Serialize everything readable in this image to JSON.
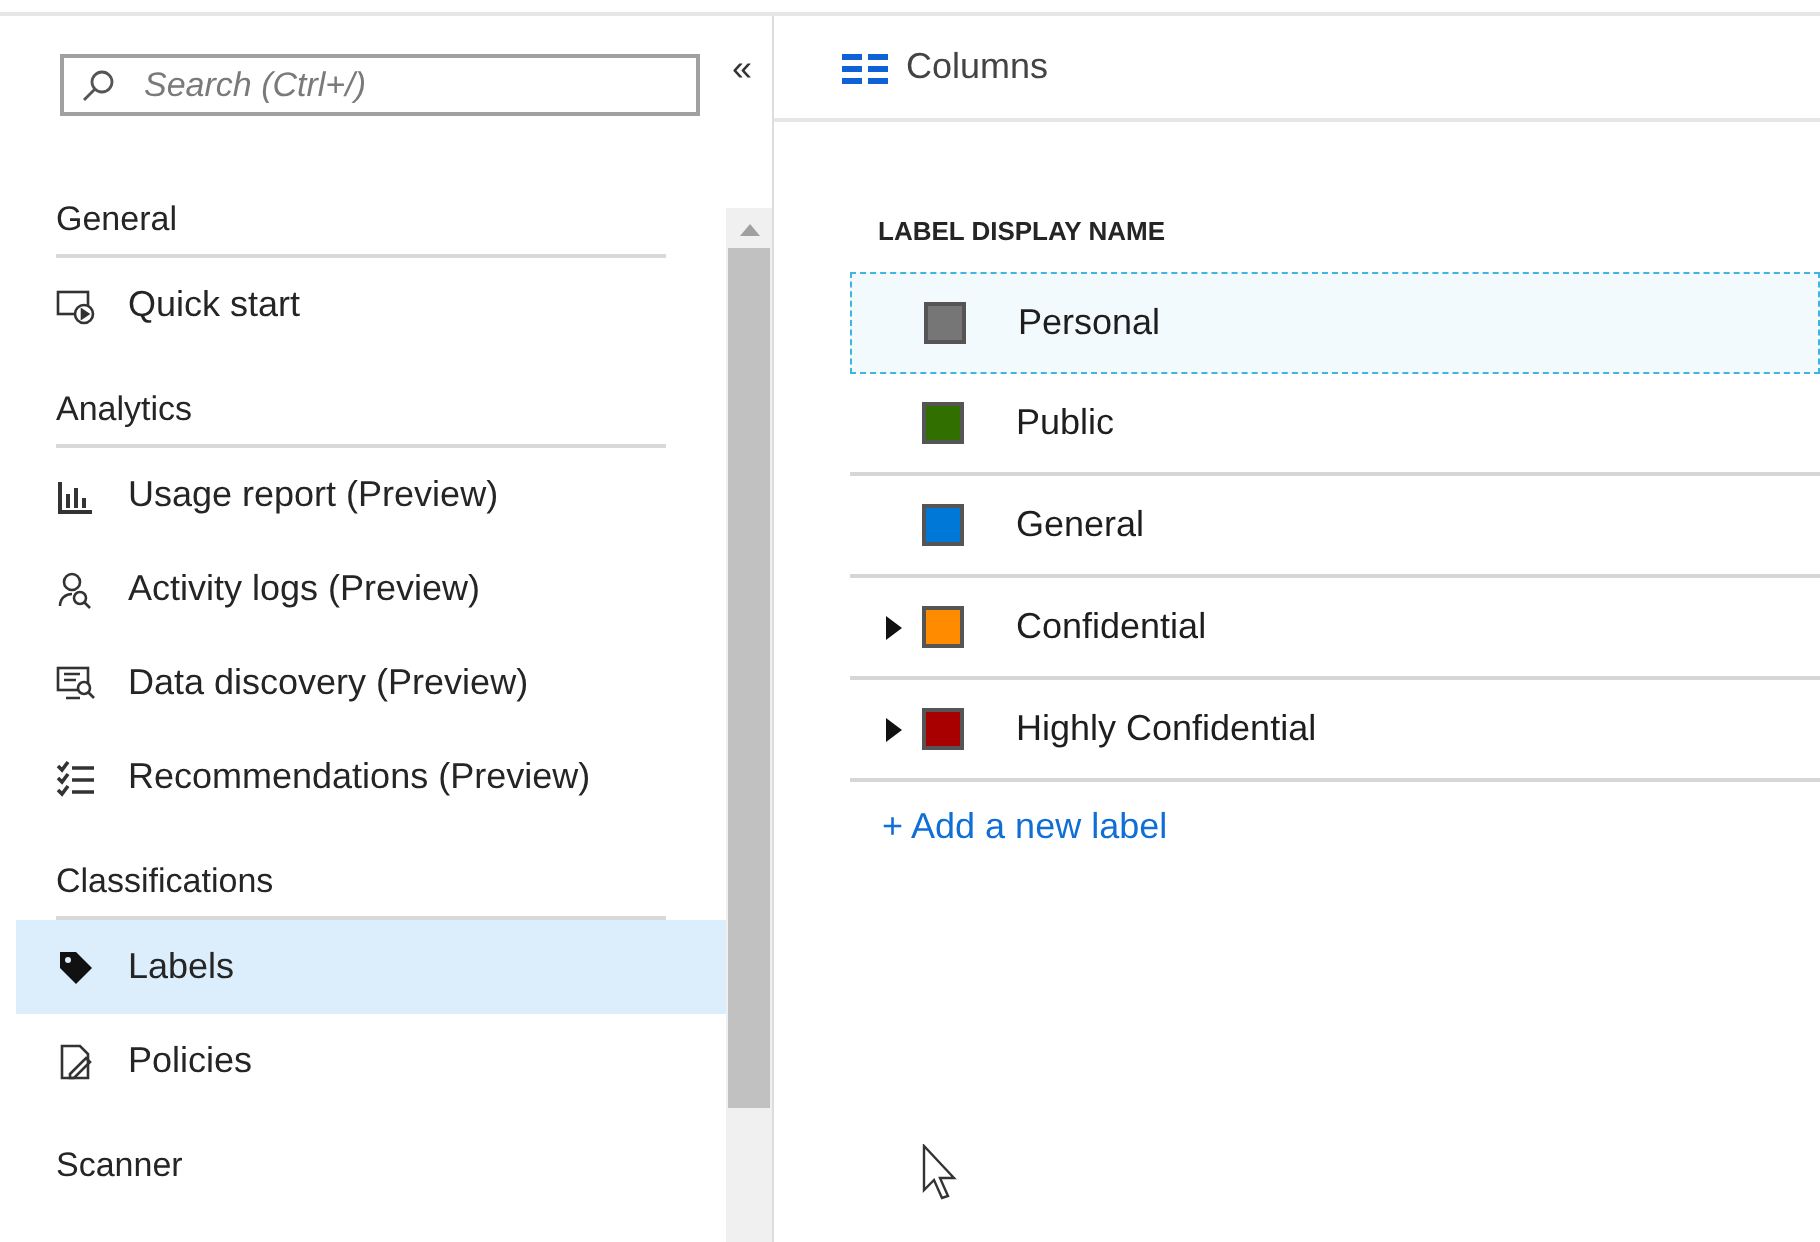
{
  "sidebar": {
    "search": {
      "placeholder": "Search (Ctrl+/)"
    },
    "collapse_button": "«",
    "sections": [
      {
        "title": "General",
        "items": [
          {
            "label": "Quick start",
            "kind": "quickstart",
            "selected": false
          }
        ]
      },
      {
        "title": "Analytics",
        "items": [
          {
            "label": "Usage report (Preview)",
            "kind": "chart",
            "selected": false
          },
          {
            "label": "Activity logs (Preview)",
            "kind": "people",
            "selected": false
          },
          {
            "label": "Data discovery (Preview)",
            "kind": "monitor",
            "selected": false
          },
          {
            "label": "Recommendations (Preview)",
            "kind": "checklist",
            "selected": false
          }
        ]
      },
      {
        "title": "Classifications",
        "items": [
          {
            "label": "Labels",
            "kind": "tag",
            "selected": true
          },
          {
            "label": "Policies",
            "kind": "document",
            "selected": false
          }
        ]
      },
      {
        "title": "Scanner"
      }
    ]
  },
  "toolbar": {
    "columns_button": "Columns"
  },
  "table": {
    "columns": [
      "LABEL DISPLAY NAME"
    ],
    "rows": [
      {
        "name": "Personal",
        "color": "#767676",
        "expandable": false,
        "selected": true
      },
      {
        "name": "Public",
        "color": "#317000",
        "expandable": false,
        "selected": false
      },
      {
        "name": "General",
        "color": "#0078d7",
        "expandable": false,
        "selected": false
      },
      {
        "name": "Confidential",
        "color": "#ff8c00",
        "expandable": true,
        "selected": false
      },
      {
        "name": "Highly Confidential",
        "color": "#a80000",
        "expandable": true,
        "selected": false
      }
    ],
    "add_link": "+ Add a new label"
  }
}
